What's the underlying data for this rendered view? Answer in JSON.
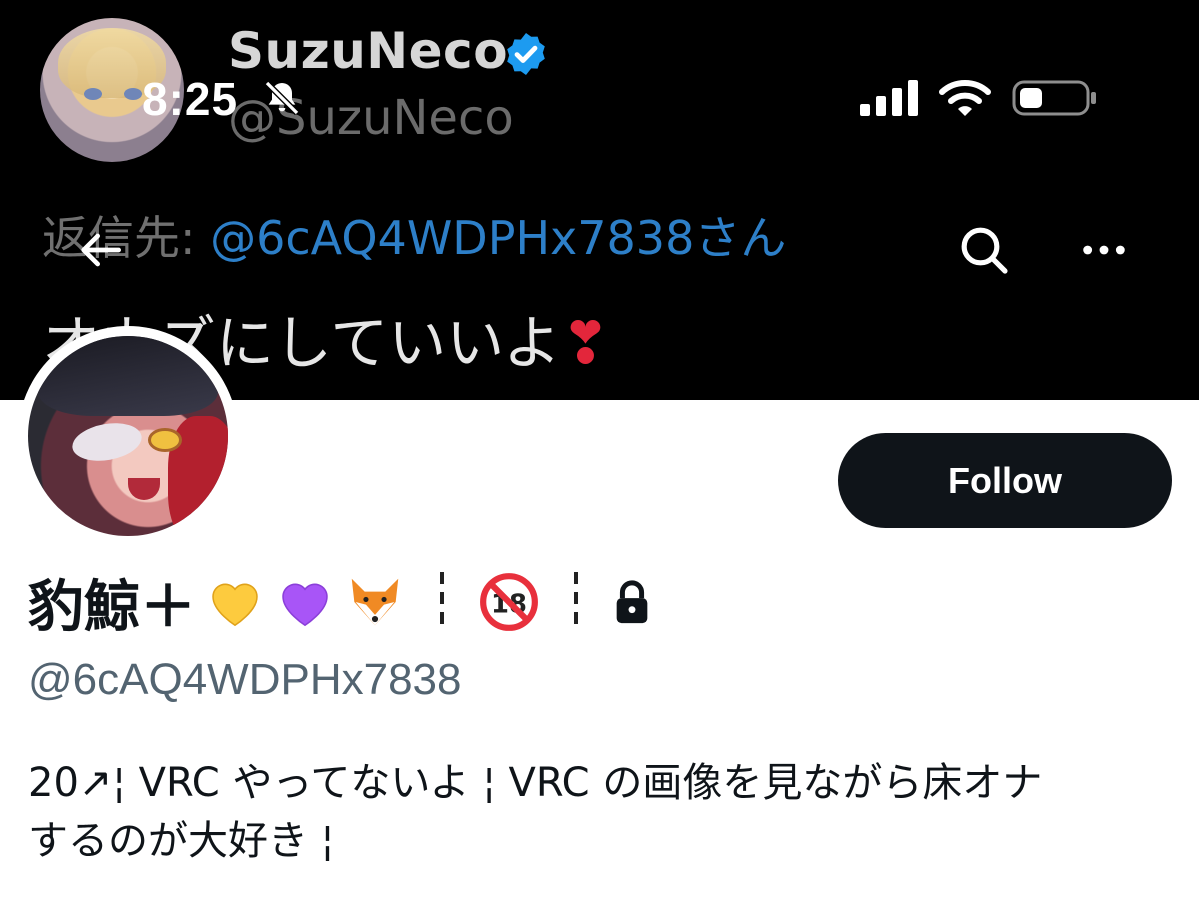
{
  "banner": {
    "author_name": "SuzuNeco",
    "author_handle": "@SuzuNeco",
    "reply_prefix": "返信先: ",
    "reply_mention": "@6cAQ4WDPHx7838さん",
    "tweet_text": "オカズにしていいよ",
    "tweet_emoji": "❣"
  },
  "status_bar": {
    "time": "8:25"
  },
  "nav": {
    "back_icon": "arrow-left-icon",
    "search_icon": "search-icon",
    "more_icon": "more-horizontal-icon"
  },
  "profile": {
    "display_name": "豹鯨＋",
    "name_emojis": [
      "yellow-heart",
      "purple-heart",
      "fox-face",
      "no-one-under-eighteen"
    ],
    "locked": true,
    "handle": "@6cAQ4WDPHx7838",
    "follow_label": "Follow",
    "bio_line1": "20↗¦ VRC やってないよ ¦ VRC の画像を見ながら床オナ",
    "bio_line2": "するのが大好き ¦"
  },
  "colors": {
    "follow_bg": "#0f1419",
    "handle": "#536471",
    "mention": "#2d7fc8",
    "verified": "#1d9bf0"
  }
}
